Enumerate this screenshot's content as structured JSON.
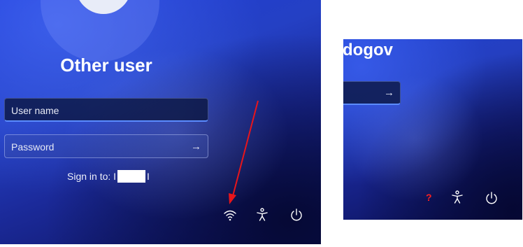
{
  "lock_screen": {
    "title": "Other user",
    "username_placeholder": "User name",
    "password_placeholder": "Password",
    "signin_label": "Sign in to: I",
    "signin_suffix": "I",
    "submit_arrow": "→",
    "icons": [
      "wifi-icon",
      "accessibility-icon",
      "power-icon"
    ]
  },
  "zoomed_panel": {
    "title_fragment": "dogov",
    "submit_arrow": "→",
    "missing_network_glyph": "?",
    "icons": [
      "question-icon",
      "accessibility-icon",
      "power-icon"
    ]
  },
  "colors": {
    "annotation_red": "#e8151b",
    "focus_blue": "#5b8cff",
    "question_red": "#ff2020"
  }
}
